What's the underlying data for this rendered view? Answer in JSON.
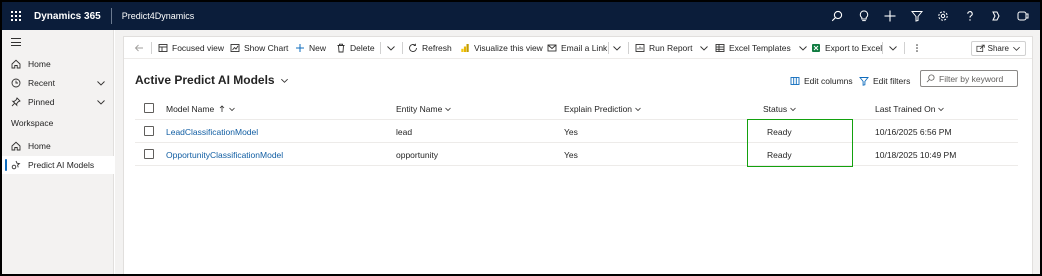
{
  "topbar": {
    "brand": "Dynamics 365",
    "app_name": "Predict4Dynamics",
    "icons": [
      "search-icon",
      "lightbulb-icon",
      "plus-icon",
      "filter-icon",
      "gear-icon",
      "help-icon",
      "copilot-icon",
      "teams-icon"
    ]
  },
  "sidebar": {
    "items": [
      {
        "label": "Home",
        "icon": "home-icon"
      },
      {
        "label": "Recent",
        "icon": "clock-icon"
      },
      {
        "label": "Pinned",
        "icon": "pin-icon"
      }
    ],
    "section_label": "Workspace",
    "workspace_items": [
      {
        "label": "Home",
        "icon": "home-icon"
      },
      {
        "label": "Predict AI Models",
        "icon": "ai-models-icon"
      }
    ]
  },
  "commandbar": {
    "back": "back-arrow-icon",
    "focused_view": "Focused view",
    "show_chart": "Show Chart",
    "new": "New",
    "delete": "Delete",
    "refresh": "Refresh",
    "visualize": "Visualize this view",
    "email_link": "Email a Link",
    "run_report": "Run Report",
    "excel_templates": "Excel Templates",
    "export_excel": "Export to Excel",
    "share": "Share"
  },
  "view": {
    "title": "Active Predict AI Models",
    "edit_columns": "Edit columns",
    "edit_filters": "Edit filters",
    "search_placeholder": "Filter by keyword"
  },
  "grid": {
    "columns": [
      "Model Name",
      "Entity Name",
      "Explain Prediction",
      "Status",
      "Last Trained On"
    ],
    "sort_column": "Model Name",
    "sort_direction": "ascending",
    "rows": [
      [
        "LeadClassificationModel",
        "lead",
        "Yes",
        "Ready",
        "10/16/2025 6:56 PM"
      ],
      [
        "OpportunityClassificationModel",
        "opportunity",
        "Yes",
        "Ready",
        "10/18/2025 10:49 PM"
      ]
    ],
    "highlight_color": "#13a10e"
  },
  "colors": {
    "topbar_bg": "#0b1d3a",
    "link": "#115ea3",
    "accent": "#0f6cbd",
    "excel_green": "#107c41"
  }
}
